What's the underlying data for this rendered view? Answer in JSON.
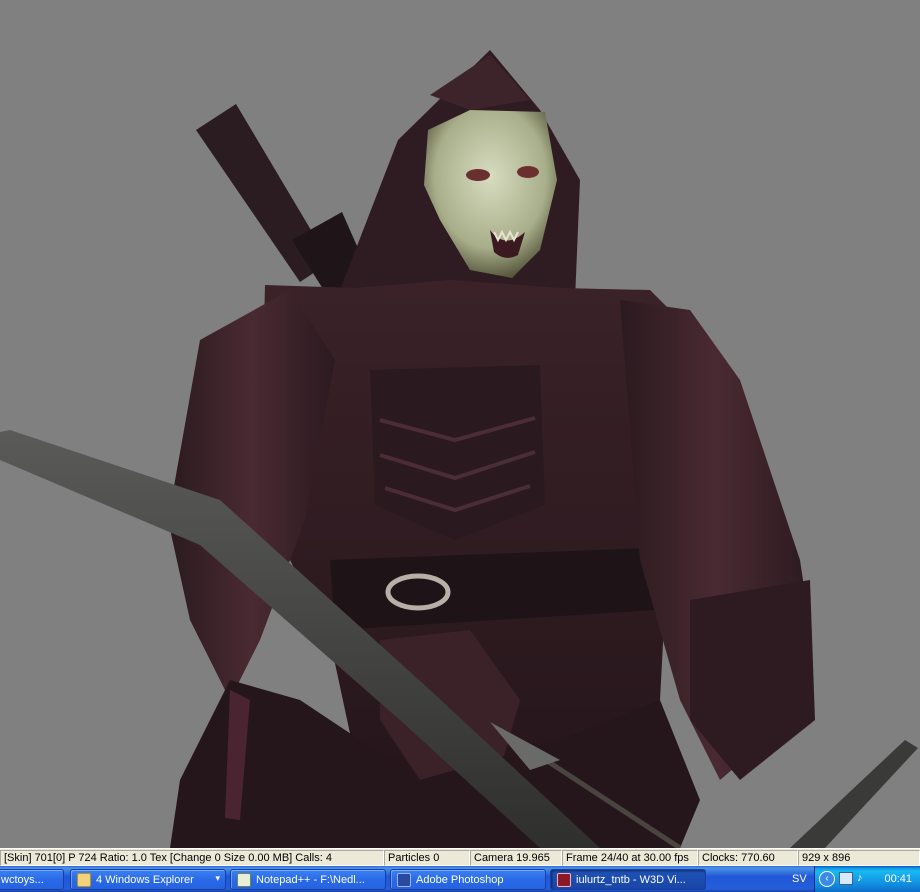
{
  "status_bar": {
    "skin": "[Skin] 701[0] P 724 Ratio: 1.0 Tex [Change 0 Size 0.00 MB] Calls: 4",
    "particles": "Particles 0",
    "camera": "Camera 19.965",
    "frame": "Frame 24/40 at 30.00 fps",
    "clocks": "Clocks: 770.60",
    "resolution": "929 x 896"
  },
  "taskbar": {
    "items": [
      {
        "label": "wctoys..."
      },
      {
        "label": "4 Windows Explorer"
      },
      {
        "label": "Notepad++ - F:\\Nedl..."
      },
      {
        "label": "Adobe Photoshop"
      },
      {
        "label": "iulurtz_tntb - W3D Vi..."
      }
    ],
    "language": "SV",
    "clock": "00:41"
  },
  "colors": {
    "viewport_bg": "#808080",
    "taskbar_blue": "#245edb",
    "tray_blue": "#139ee9"
  }
}
